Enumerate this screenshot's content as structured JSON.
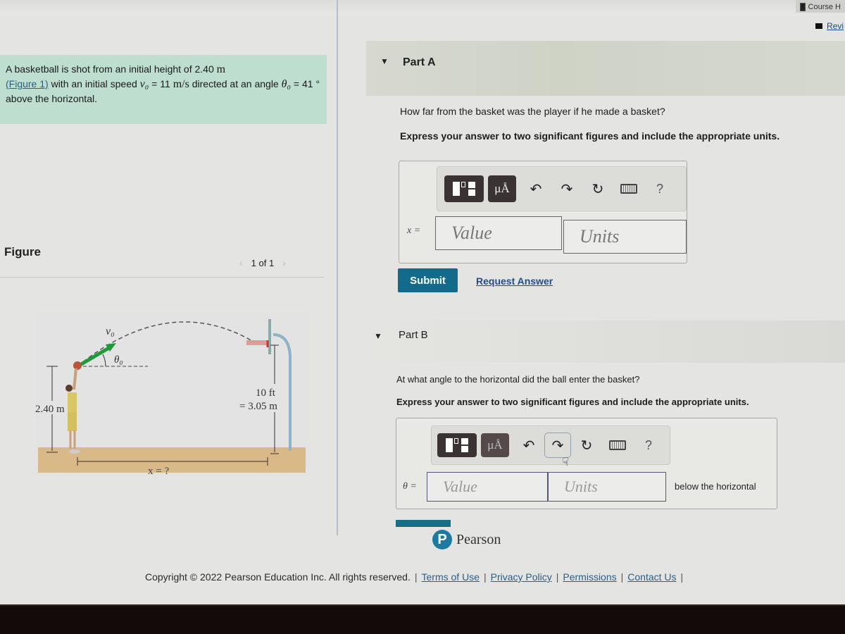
{
  "header": {
    "course_home_label": "Course H",
    "review_label": "Revi"
  },
  "problem": {
    "text_1": "A basketball is shot from an initial height of 2.40 ",
    "unit_height": "m",
    "figure_link": "(Figure 1)",
    "text_2": " with an initial speed ",
    "v0_symbol": "v₀",
    "text_3": " = 11 ",
    "unit_speed": "m/s",
    "text_4": " directed at an angle ",
    "theta_symbol": "θ₀",
    "text_5": " = 41 ° above the horizontal."
  },
  "figure": {
    "title": "Figure",
    "pager": "1 of 1",
    "prev_icon": "chevron-left-icon",
    "next_icon": "chevron-right-icon",
    "labels": {
      "v0": "v₀",
      "theta0": "θ₀",
      "height": "2.40 m",
      "rim_ft": "10 ft",
      "rim_m": "= 3.05 m",
      "distance": "x = ?"
    }
  },
  "part_a": {
    "title": "Part A",
    "question": "How far from the basket was the player if he made a basket?",
    "instruction": "Express your answer to two significant figures and include the appropriate units.",
    "variable": "x =",
    "value_placeholder": "Value",
    "units_placeholder": "Units",
    "submit_label": "Submit",
    "request_answer_label": "Request Answer"
  },
  "part_b": {
    "title": "Part B",
    "question": "At what angle to the horizontal did the ball enter the basket?",
    "instruction": "Express your answer to two significant figures and include the appropriate units.",
    "variable": "θ =",
    "value_placeholder": "Value",
    "units_placeholder": "Units",
    "after_text": "below the horizontal"
  },
  "toolbar": {
    "templates_icon": "templates-icon",
    "units_icon_label": "μÅ",
    "undo_icon": "↶",
    "redo_icon": "↷",
    "reset_icon": "↻",
    "keyboard_icon": "keyboard-icon",
    "help_label": "?"
  },
  "footer": {
    "pearson_label": "Pearson",
    "pearson_logo": "P",
    "copyright": "Copyright © 2022 Pearson Education Inc. All rights reserved.",
    "links": [
      "Terms of Use",
      "Privacy Policy",
      "Permissions",
      "Contact Us"
    ],
    "separator": "|"
  },
  "colors": {
    "problem_bg": "#bedfcf",
    "submit_bg": "#126b8c",
    "link": "#1f4e87",
    "vector_green": "#1f9a3a"
  }
}
